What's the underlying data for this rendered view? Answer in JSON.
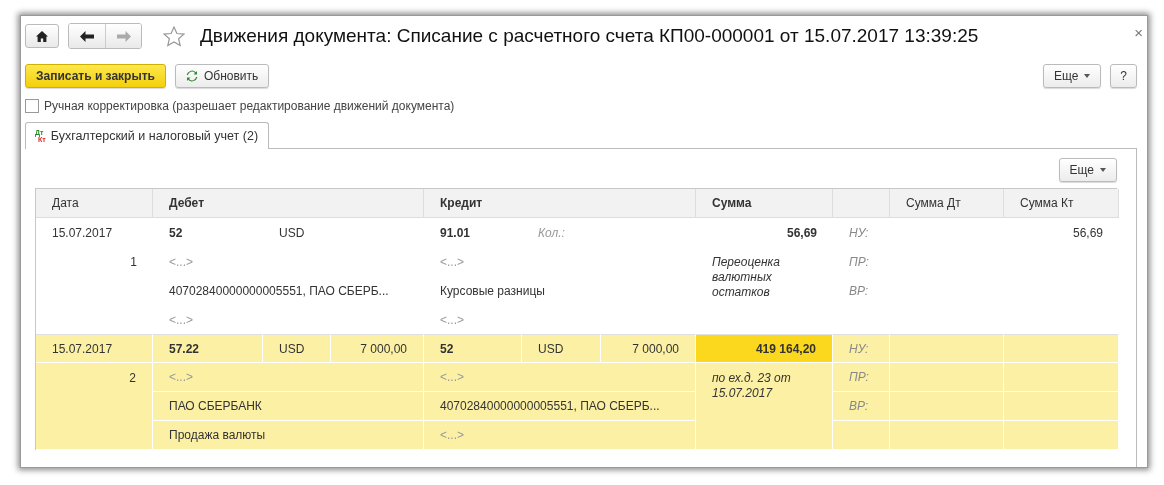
{
  "window": {
    "title": "Движения документа: Списание с расчетного счета КП00-000001 от 15.07.2017 13:39:25",
    "close": "×",
    "favorite": false
  },
  "nav": {
    "back": {
      "disabled": false
    },
    "forward": {
      "disabled": true
    }
  },
  "toolbar": {
    "primary": "Записать и закрыть",
    "refresh": "Обновить",
    "more": "Еще",
    "help": "?"
  },
  "manual_edit": {
    "label": "Ручная корректировка (разрешает редактирование движений документа)",
    "checked": false
  },
  "tabs": [
    {
      "label": "Бухгалтерский и налоговый учет (2)",
      "icon_top": "Дт",
      "icon_bottom": "Кт",
      "selected": true
    }
  ],
  "table_toolbar": {
    "more": "Еще"
  },
  "table": {
    "columns": [
      {
        "label": "Дата",
        "bold": false
      },
      {
        "label": "Дебет",
        "bold": true
      },
      {
        "label": "Кредит",
        "bold": true
      },
      {
        "label": "Сумма",
        "bold": true
      },
      {
        "label": "Сумма Дт",
        "bold": false
      },
      {
        "label": "Сумма Кт",
        "bold": false
      }
    ],
    "rows": [
      {
        "selected": false,
        "sum_focused": false,
        "date": "15.07.2017",
        "number": "1",
        "debit": {
          "account": "52",
          "currency": "USD",
          "subconto": [
            {
              "text": "<...>",
              "empty": true
            },
            {
              "text": "40702840000000005551, ПАО СБЕРБ...",
              "empty": false
            },
            {
              "text": "<...>",
              "empty": true
            }
          ]
        },
        "credit": {
          "account": "91.01",
          "quantity_label": "Кол.:",
          "subconto": [
            {
              "text": "<...>",
              "empty": true
            },
            {
              "text": "Курсовые разницы",
              "empty": false
            },
            {
              "text": "<...>",
              "empty": true
            }
          ]
        },
        "sum": "56,69",
        "content": "Переоценка валютных остатков",
        "tax_labels": [
          "НУ:",
          "ПР:",
          "ВР:"
        ],
        "sum_kt": "56,69"
      },
      {
        "selected": true,
        "sum_focused": true,
        "date": "15.07.2017",
        "number": "2",
        "debit": {
          "account": "57.22",
          "currency": "USD",
          "amount": "7 000,00",
          "subconto": [
            {
              "text": "<...>",
              "empty": true
            },
            {
              "text": "ПАО СБЕРБАНК",
              "empty": false
            },
            {
              "text": "Продажа валюты",
              "empty": false
            }
          ]
        },
        "credit": {
          "account": "52",
          "currency": "USD",
          "amount": "7 000,00",
          "subconto": [
            {
              "text": "<...>",
              "empty": true
            },
            {
              "text": "40702840000000005551, ПАО СБЕРБ...",
              "empty": false
            },
            {
              "text": "<...>",
              "empty": true
            }
          ]
        },
        "sum": "419 164,20",
        "content": "по ех.д. 23 от 15.07.2017",
        "tax_labels": [
          "НУ:",
          "ПР:",
          "ВР:"
        ]
      }
    ]
  }
}
